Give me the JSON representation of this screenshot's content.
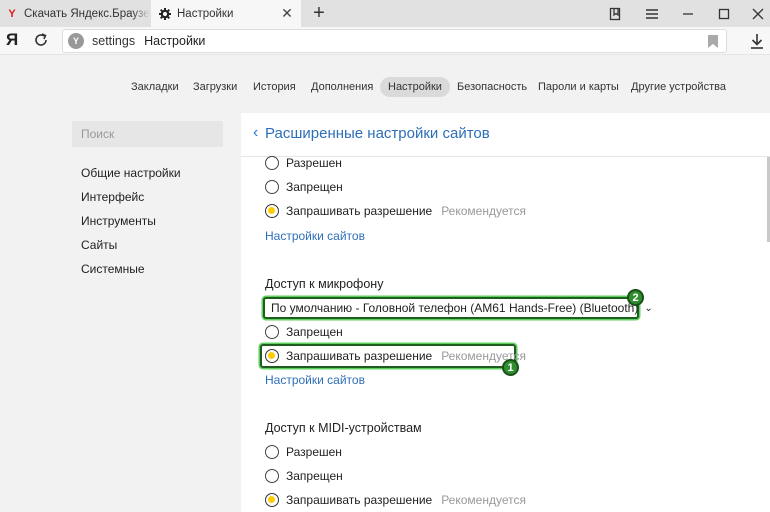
{
  "tabs": [
    {
      "title": "Скачать Яндекс.Браузер д",
      "favicon": "Y"
    },
    {
      "title": "Настройки"
    }
  ],
  "address": {
    "brand": "Я",
    "url_part1": "settings",
    "url_part2": "Настройки"
  },
  "top_nav": [
    "Закладки",
    "Загрузки",
    "История",
    "Дополнения",
    "Настройки",
    "Безопасность",
    "Пароли и карты",
    "Другие устройства"
  ],
  "top_nav_active": "Настройки",
  "sidebar": {
    "search_placeholder": "Поиск",
    "items": [
      "Общие настройки",
      "Интерфейс",
      "Инструменты",
      "Сайты",
      "Системные"
    ]
  },
  "panel": {
    "title": "Расширенные настройки сайтов",
    "group1": {
      "options": [
        {
          "label": "Разрешен",
          "selected": false
        },
        {
          "label": "Запрещен",
          "selected": false
        },
        {
          "label": "Запрашивать разрешение",
          "selected": true,
          "hint": "Рекомендуется"
        }
      ],
      "link": "Настройки сайтов"
    },
    "microphone": {
      "heading": "Доступ к микрофону",
      "select_value": "По умолчанию - Головной телефон (AM61 Hands-Free) (Bluetooth)",
      "options": [
        {
          "label": "Запрещен",
          "selected": false
        },
        {
          "label": "Запрашивать разрешение",
          "selected": true,
          "hint": "Рекомендуется"
        }
      ],
      "link": "Настройки сайтов"
    },
    "midi": {
      "heading": "Доступ к MIDI-устройствам",
      "options": [
        {
          "label": "Разрешен",
          "selected": false
        },
        {
          "label": "Запрещен",
          "selected": false
        },
        {
          "label": "Запрашивать разрешение",
          "selected": true,
          "hint": "Рекомендуется"
        }
      ]
    }
  },
  "annotations": {
    "badge1": "1",
    "badge2": "2"
  },
  "colors": {
    "accent_link": "#2d6fb8",
    "radio_fill": "#ffcc00",
    "highlight": "#5fd05f"
  }
}
